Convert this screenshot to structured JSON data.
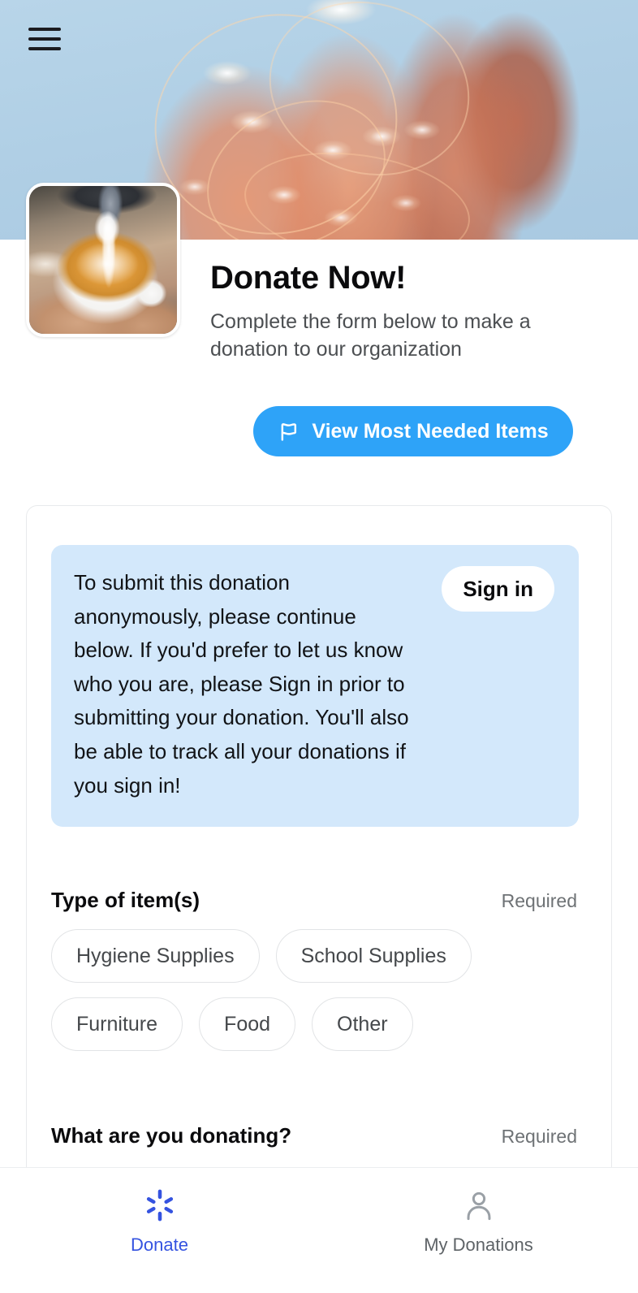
{
  "theme": {
    "accent_blue": "#2EA3F8",
    "notice_blue": "#D3E8FB",
    "active_tab_blue": "#3553E0",
    "inactive_tab_gray": "#5E6367",
    "hero_sky_blue": "#B0CFE5"
  },
  "header": {
    "menu_icon": "hamburger-menu-icon",
    "hero_image_alt": "open-hand-holding-fairy-lights",
    "thumbnail_alt": "latte-being-poured-into-cup",
    "title": "Donate Now!",
    "subtitle": "Complete the form below to make a donation to our organization",
    "cta": {
      "icon": "flag-icon",
      "label": "View Most Needed Items"
    }
  },
  "form": {
    "notice": {
      "text": "To submit this donation anonymously, please continue below. If you'd prefer to let us know who you are, please Sign in prior to submitting your donation. You'll also be able to track all your donations if you sign in!",
      "signin_label": "Sign in"
    },
    "fields": [
      {
        "label": "Type of item(s)",
        "required_text": "Required",
        "chip_rows": [
          [
            "Hygiene Supplies",
            "School Supplies"
          ],
          [
            "Furniture",
            "Food",
            "Other"
          ]
        ]
      },
      {
        "label": "What are you donating?",
        "required_text": "Required"
      }
    ]
  },
  "tab_bar": {
    "tabs": [
      {
        "label": "Donate",
        "icon": "sparkle-burst-icon",
        "active": true
      },
      {
        "label": "My Donations",
        "icon": "person-icon",
        "active": false
      }
    ]
  }
}
